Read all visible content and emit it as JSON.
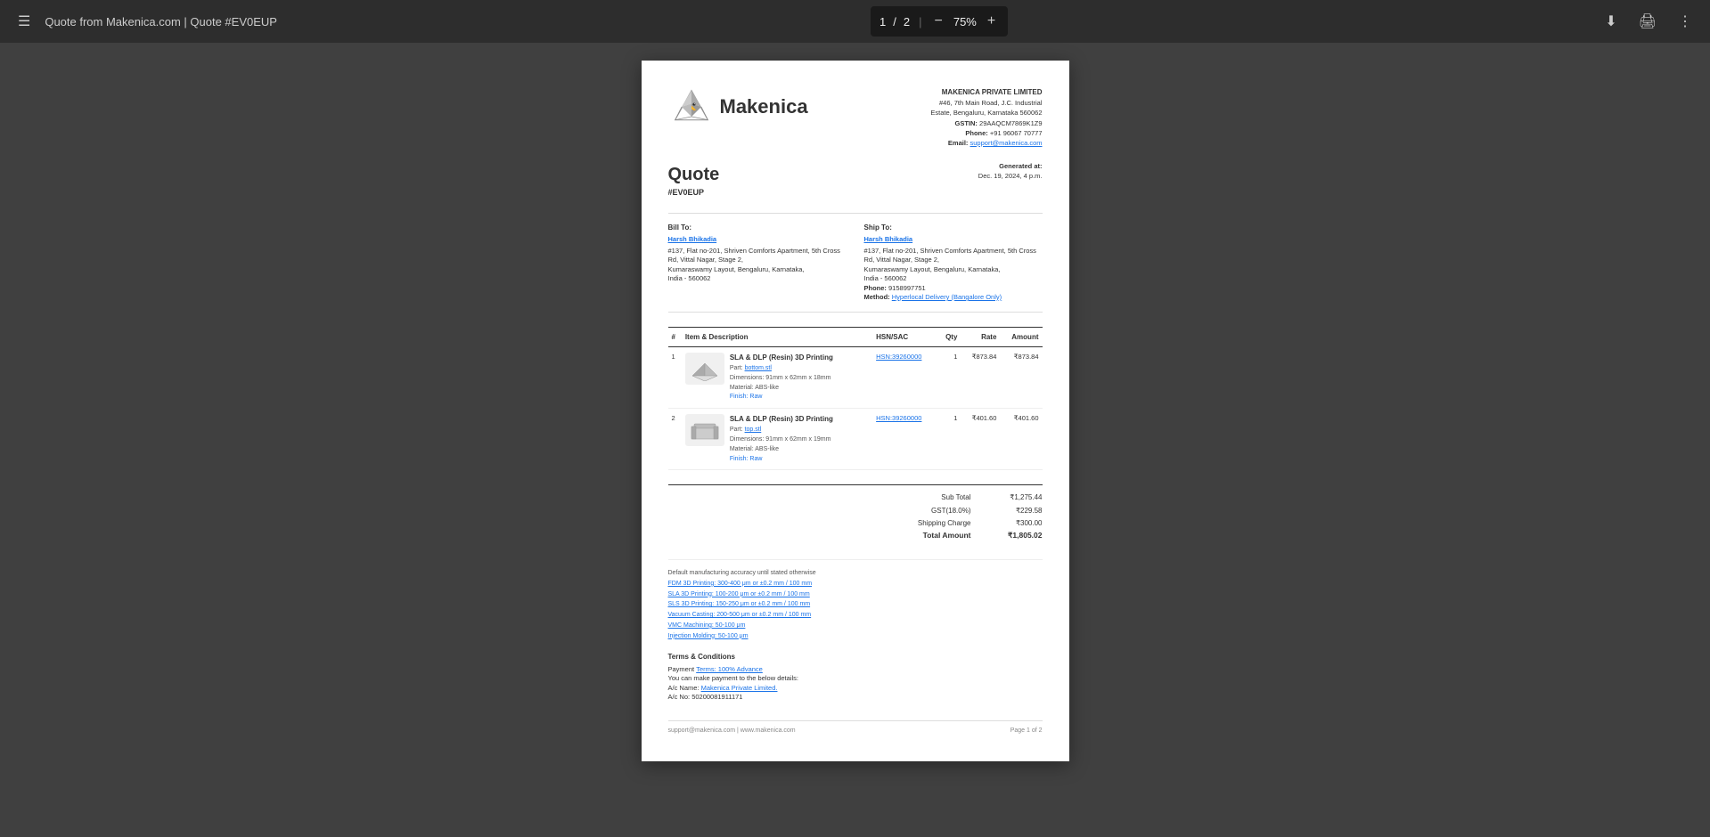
{
  "toolbar": {
    "hamburger_label": "☰",
    "title": "Quote from Makenica.com | Quote #EV0EUP",
    "page_current": "1",
    "page_separator": "/",
    "page_total": "2",
    "zoom_out": "−",
    "zoom_level": "75%",
    "zoom_in": "+",
    "save_icon": "⬇",
    "print_icon": "🖨",
    "more_icon": "⋮",
    "download_title": "Download",
    "print_title": "Print",
    "more_title": "More"
  },
  "document": {
    "company": {
      "name": "MAKENICA PRIVATE LIMITED",
      "address_line1": "#46, 7th Main Road, J.C. Industrial",
      "address_line2": "Estate, Bengaluru, Karnataka 560062",
      "gstin_label": "GSTIN:",
      "gstin_value": "29AAQCM7869K1Z9",
      "phone_label": "Phone:",
      "phone_value": "+91 96067 70777",
      "email_label": "Email:",
      "email_value": "support@makenica.com"
    },
    "quote": {
      "title": "Quote",
      "number": "#EV0EUP",
      "generated_label": "Generated at:",
      "generated_date": "Dec. 19, 2024, 4 p.m."
    },
    "bill_to": {
      "label": "Bill To:",
      "name": "Harsh Bhikadia",
      "address": "#137, Flat no-201, Shriven Comforts Apartment, 5th Cross Rd, Vittal Nagar, Stage 2,",
      "city": "Kumaraswamy Layout, Bengaluru, Karnataka,",
      "country": "India - 560062"
    },
    "ship_to": {
      "label": "Ship To:",
      "name": "Harsh Bhikadia",
      "address": "#137, Flat no-201, Shriven Comforts Apartment, 5th Cross Rd, Vittal Nagar, Stage 2,",
      "city": "Kumaraswamy Layout, Bengaluru, Karnataka,",
      "country": "India - 560062",
      "phone_label": "Phone:",
      "phone_value": "9158997751",
      "method_label": "Method:",
      "method_value": "Hyperlocal Delivery (Bangalore Only)"
    },
    "table": {
      "headers": [
        "#",
        "Item & Description",
        "HSN/SAC",
        "Qty",
        "Rate",
        "Amount"
      ],
      "items": [
        {
          "number": "1",
          "service": "SLA & DLP (Resin) 3D Printing",
          "part_label": "Part:",
          "part_name": "bottom.stl",
          "dimensions_label": "Dimensions:",
          "dimensions_value": "91mm x 62mm x 18mm",
          "material_label": "Material:",
          "material_value": "ABS-like",
          "finish_label": "Finish:",
          "finish_value": "Raw",
          "hsn": "HSN:39260000",
          "qty": "1",
          "rate": "₹873.84",
          "amount": "₹873.84"
        },
        {
          "number": "2",
          "service": "SLA & DLP (Resin) 3D Printing",
          "part_label": "Part:",
          "part_name": "top.stl",
          "dimensions_label": "Dimensions:",
          "dimensions_value": "91mm x 62mm x 19mm",
          "material_label": "Material:",
          "material_value": "ABS-like",
          "finish_label": "Finish:",
          "finish_value": "Raw",
          "hsn": "HSN:39260000",
          "qty": "1",
          "rate": "₹401.60",
          "amount": "₹401.60"
        }
      ]
    },
    "totals": {
      "sub_total_label": "Sub Total",
      "sub_total_value": "₹1,275.44",
      "gst_label": "GST(18.0%)",
      "gst_value": "₹229.58",
      "shipping_label": "Shipping Charge",
      "shipping_value": "₹300.00",
      "total_label": "Total Amount",
      "total_value": "₹1,805.02"
    },
    "notes": {
      "default_accuracy": "Default manufacturing accuracy until stated otherwise",
      "fdm": "FDM 3D Printing: 300-400 μm or ±0.2 mm / 100 mm",
      "sla": "SLA 3D Printing: 100-200 μm or ±0.2 mm / 100 mm",
      "sls": "SLS 3D Printing: 150-250 μm or ±0.2 mm / 100 mm",
      "vacuum": "Vacuum Casting: 200-500 μm or ±0.2 mm / 100 mm",
      "vmc": "VMC Machining: 50-100 μm",
      "injection": "Injection Molding: 50-100 μm"
    },
    "terms": {
      "title": "Terms & Conditions",
      "payment_label": "Payment",
      "payment_value": "Terms: 100% Advance",
      "payment_note": "You can make payment to the below details:",
      "ac_name_label": "A/c Name:",
      "ac_name_value": "Makenica Private Limited.",
      "ac_no_label": "A/c No:",
      "ac_no_value": "50200081911171"
    },
    "footer": {
      "email": "support@makenica.com | www.makenica.com",
      "page": "Page 1 of 2"
    }
  }
}
